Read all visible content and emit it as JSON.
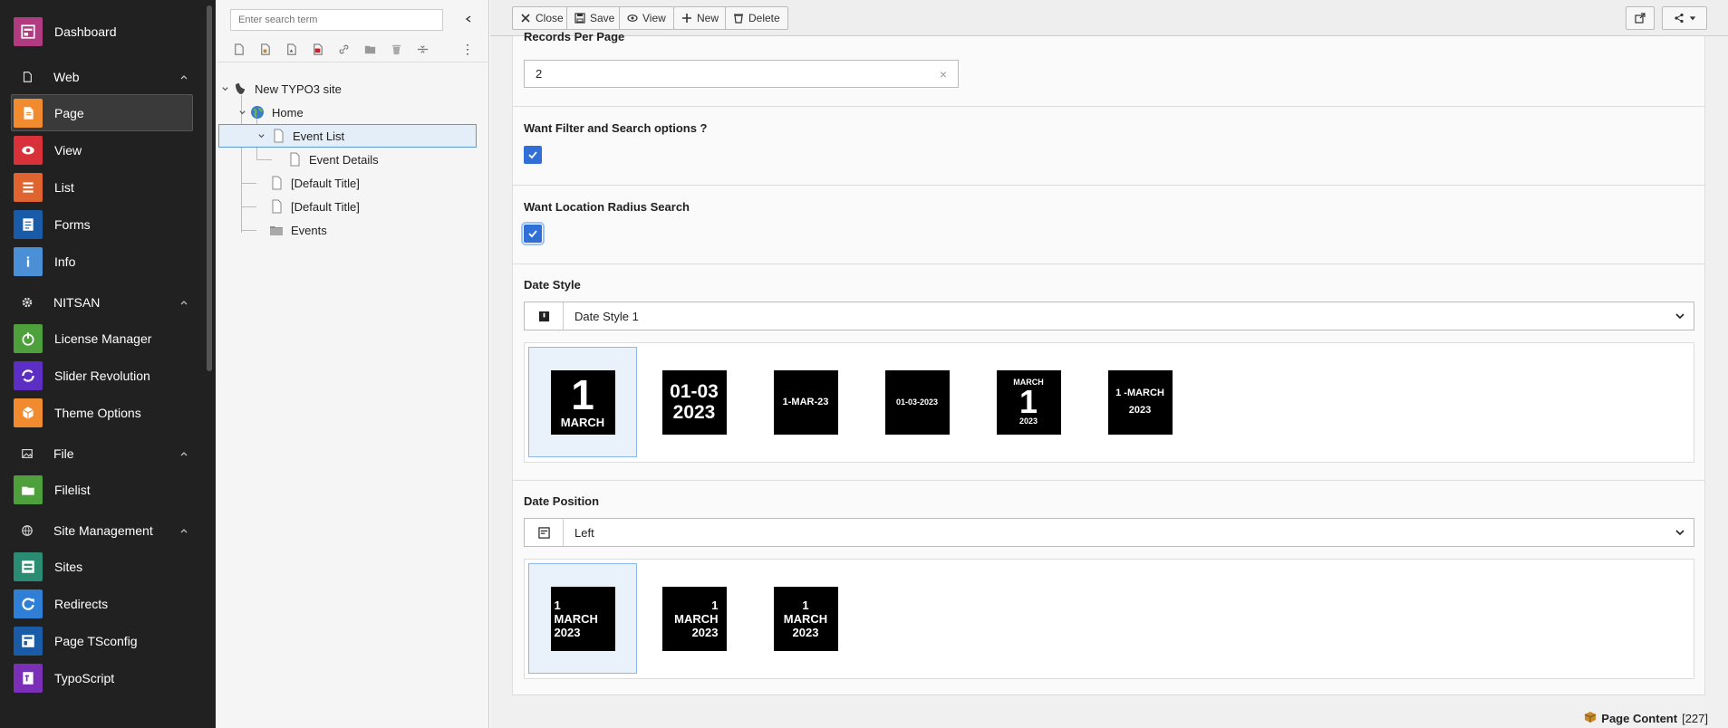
{
  "module_menu": {
    "dashboard": "Dashboard",
    "groups": [
      {
        "label": "Web",
        "items": [
          "Page",
          "View",
          "List",
          "Forms",
          "Info"
        ]
      },
      {
        "label": "NITSAN",
        "items": [
          "License Manager",
          "Slider Revolution",
          "Theme Options"
        ]
      },
      {
        "label": "File",
        "items": [
          "Filelist"
        ]
      },
      {
        "label": "Site Management",
        "items": [
          "Sites",
          "Redirects",
          "Page TSconfig",
          "TypoScript"
        ]
      }
    ],
    "active_item": "Page",
    "colors": {
      "dashboard": "#b13b80",
      "page": "#f08c2f",
      "view": "#d9313a",
      "list": "#e0642f",
      "forms": "#1a5ba8",
      "info": "#4b90d6",
      "license": "#4ea03c",
      "slider": "#5c2ec3",
      "theme": "#f08c2f",
      "filelist": "#4ea03c",
      "sites": "#2a8d73",
      "redirects": "#2f7fd6",
      "tsconfig": "#1a5ba8",
      "typoscript": "#7b2fb6"
    }
  },
  "page_tree": {
    "search_placeholder": "Enter search term",
    "nodes": {
      "root": "New TYPO3 site",
      "home": "Home",
      "event_list": "Event List",
      "event_details": "Event Details",
      "default1": "[Default Title]",
      "default2": "[Default Title]",
      "events": "Events"
    }
  },
  "toolbar": {
    "close": "Close",
    "save": "Save",
    "view": "View",
    "new": "New",
    "delete": "Delete"
  },
  "form": {
    "records_label": "Records Per Page",
    "records_value": "2",
    "filter_label": "Want Filter and Search options ?",
    "filter_checked": true,
    "radius_label": "Want Location Radius Search",
    "radius_checked": true,
    "date_style_label": "Date Style",
    "date_style_value": "Date Style 1",
    "date_styles": {
      "s1": {
        "big": "1",
        "small": "MARCH"
      },
      "s2": {
        "line1": "01-03",
        "line2": "2023"
      },
      "s3": "1-MAR-23",
      "s4": "01-03-2023",
      "s5": {
        "top": "MARCH",
        "big": "1",
        "bottom": "2023"
      },
      "s6": {
        "line1": "1 -MARCH",
        "line2": "2023"
      }
    },
    "date_position_label": "Date Position",
    "date_position_value": "Left",
    "date_positions": {
      "day": "1",
      "month": "MARCH",
      "year": "2023"
    }
  },
  "footer": {
    "record_type": "Page Content",
    "record_id": "[227]"
  }
}
